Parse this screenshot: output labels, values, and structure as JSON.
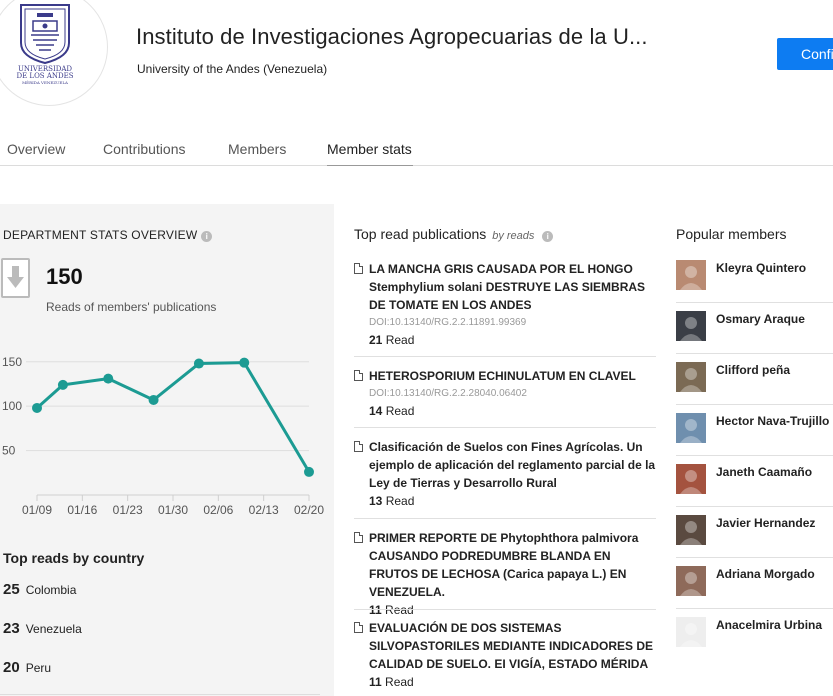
{
  "header": {
    "title": "Instituto de Investigaciones Agropecuarias de la U...",
    "subtitle": "University of the Andes (Venezuela)",
    "confirm_label": "Confi",
    "logo_text_line1": "UNIVERSIDAD",
    "logo_text_line2": "DE LOS ANDES",
    "logo_text_line3": "MÉRIDA VENEZUELA"
  },
  "tabs": [
    {
      "label": "Overview",
      "active": false
    },
    {
      "label": "Contributions",
      "active": false
    },
    {
      "label": "Members",
      "active": false
    },
    {
      "label": "Member stats",
      "active": true
    }
  ],
  "stats": {
    "heading": "DEPARTMENT STATS OVERVIEW",
    "reads_count": "150",
    "reads_caption": "Reads of members' publications"
  },
  "chart_data": {
    "type": "line",
    "x": [
      "01/09",
      "01/16",
      "01/23",
      "01/30",
      "02/06",
      "02/13",
      "02/20"
    ],
    "points": [
      {
        "date": "01/09",
        "value": 98
      },
      {
        "date": "01/13",
        "value": 124
      },
      {
        "date": "01/20",
        "value": 131
      },
      {
        "date": "01/27",
        "value": 107
      },
      {
        "date": "02/03",
        "value": 148
      },
      {
        "date": "02/10",
        "value": 149
      },
      {
        "date": "02/20",
        "value": 26
      }
    ],
    "yticks": [
      50,
      100,
      150
    ],
    "ylim": [
      0,
      170
    ],
    "grid": true,
    "color": "#1c9b93"
  },
  "countries": {
    "title": "Top reads by country",
    "items": [
      {
        "count": "25",
        "name": "Colombia"
      },
      {
        "count": "23",
        "name": "Venezuela"
      },
      {
        "count": "20",
        "name": "Peru"
      }
    ]
  },
  "publications": {
    "title": "Top read publications",
    "by_label": "by reads",
    "items": [
      {
        "title": "LA MANCHA GRIS CAUSADA POR EL HONGO Stemphylium solani DESTRUYE LAS SIEMBRAS DE TOMATE EN LOS ANDES",
        "doi": "DOI:10.13140/RG.2.2.11891.99369",
        "reads": "21",
        "reads_label": "Read"
      },
      {
        "title": "HETEROSPORIUM ECHINULATUM EN CLAVEL",
        "doi": "DOI:10.13140/RG.2.2.28040.06402",
        "reads": "14",
        "reads_label": "Read"
      },
      {
        "title": "Clasificación de Suelos con Fines Agrícolas. Un ejemplo de aplicación del reglamento parcial de la Ley de Tierras y Desarrollo Rural",
        "doi": "",
        "reads": "13",
        "reads_label": "Read"
      },
      {
        "title": "PRIMER REPORTE DE Phytophthora palmivora CAUSANDO PODREDUMBRE BLANDA EN FRUTOS DE LECHOSA (Carica papaya L.) EN VENEZUELA.",
        "doi": "",
        "reads": "11",
        "reads_label": "Read"
      },
      {
        "title": "EVALUACIÓN DE DOS SISTEMAS SILVOPASTORILES MEDIANTE INDICADORES DE CALIDAD DE SUELO. EI VIGÍA, ESTADO MÉRIDA",
        "doi": "",
        "reads": "11",
        "reads_label": "Read"
      }
    ]
  },
  "members": {
    "title": "Popular members",
    "items": [
      {
        "name": "Kleyra Quintero",
        "avatar_color": "#b98a72"
      },
      {
        "name": "Osmary Araque",
        "avatar_color": "#3a3e46"
      },
      {
        "name": "Clifford peña",
        "avatar_color": "#7b6a54"
      },
      {
        "name": "Hector Nava-Trujillo",
        "avatar_color": "#6f8fae"
      },
      {
        "name": "Janeth Caamaño",
        "avatar_color": "#a4533f"
      },
      {
        "name": "Javier Hernandez",
        "avatar_color": "#5a4a40"
      },
      {
        "name": "Adriana Morgado",
        "avatar_color": "#8e6a5a"
      },
      {
        "name": "Anacelmira Urbina",
        "avatar_color": "#eeeeee"
      }
    ]
  }
}
